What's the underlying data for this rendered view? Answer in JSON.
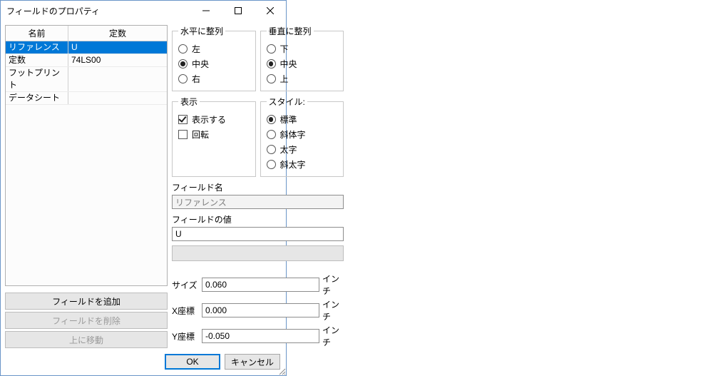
{
  "title": "フィールドのプロパティ",
  "grid": {
    "headers": [
      "名前",
      "定数"
    ],
    "rows": [
      {
        "name": "リファレンス",
        "value": "U",
        "selected": true
      },
      {
        "name": "定数",
        "value": "74LS00",
        "selected": false
      },
      {
        "name": "フットプリント",
        "value": "",
        "selected": false
      },
      {
        "name": "データシート",
        "value": "",
        "selected": false
      }
    ]
  },
  "buttons": {
    "add": "フィールドを追加",
    "del": "フィールドを削除",
    "up": "上に移動"
  },
  "halign": {
    "legend": "水平に整列",
    "left": "左",
    "center": "中央",
    "right": "右",
    "value": "center"
  },
  "valign": {
    "legend": "垂直に整列",
    "bottom": "下",
    "center": "中央",
    "top": "上",
    "value": "center"
  },
  "visible": {
    "legend": "表示",
    "show": "表示する",
    "show_on": true,
    "rotate": "回転",
    "rotate_on": false
  },
  "style": {
    "legend": "スタイル:",
    "normal": "標準",
    "italic": "斜体字",
    "bold": "太字",
    "bolditalic": "斜太字",
    "value": "normal"
  },
  "fieldname": {
    "label": "フィールド名",
    "value": "リファレンス"
  },
  "fieldvalue": {
    "label": "フィールドの値",
    "value": "U"
  },
  "size": {
    "label": "サイズ",
    "value": "0.060",
    "unit": "インチ"
  },
  "px": {
    "label": "X座標",
    "value": "0.000",
    "unit": "インチ"
  },
  "py": {
    "label": "Y座標",
    "value": "-0.050",
    "unit": "インチ"
  },
  "ok": "OK",
  "cancel": "キャンセル"
}
